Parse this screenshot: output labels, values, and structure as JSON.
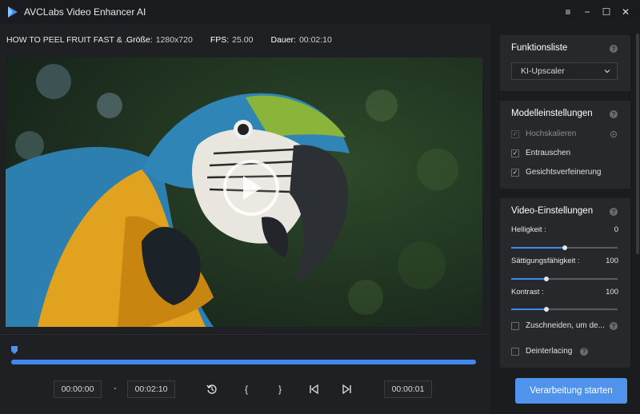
{
  "app": {
    "title": "AVCLabs Video Enhancer AI",
    "logo_color": "#3f8cf0"
  },
  "window_controls": {
    "menu": "≡",
    "minimize": "−",
    "maximize": "☐",
    "close": "✕"
  },
  "info": {
    "video_title": "HOW TO PEEL FRUIT FAST & ...",
    "size_label": "Größe:",
    "size_value": "1280x720",
    "fps_label": "FPS:",
    "fps_value": "25.00",
    "duration_label": "Dauer:",
    "duration_value": "00:02:10"
  },
  "timeline": {
    "progress_percent": 100,
    "color": "#3f88ee"
  },
  "controls": {
    "start_time": "00:00:00",
    "separator": "-",
    "end_time": "00:02:10",
    "current_time": "00:00:01",
    "icons": [
      "history-icon",
      "mark-in-icon",
      "mark-out-icon",
      "skip-start-icon",
      "skip-end-icon"
    ],
    "mark_in_glyph": "{",
    "mark_out_glyph": "}"
  },
  "panel": {
    "function_list": {
      "title": "Funktionsliste",
      "selected": "KI-Upscaler"
    },
    "model_settings": {
      "title": "Modelleinstellungen",
      "options": [
        {
          "label": "Hochskalieren",
          "checked": true,
          "disabled": true
        },
        {
          "label": "Entrauschen",
          "checked": true,
          "disabled": false
        },
        {
          "label": "Gesichtsverfeinerung",
          "checked": true,
          "disabled": false
        }
      ]
    },
    "video_settings": {
      "title": "Video-Einstellungen",
      "brightness": {
        "label": "Helligkeit :",
        "value": "0",
        "level_percent": 50
      },
      "saturation": {
        "label": "Sättigungsfähigkeit :",
        "value": "100",
        "level_percent": 33
      },
      "contrast": {
        "label": "Kontrast :",
        "value": "100",
        "level_percent": 33
      },
      "crop": {
        "label": "Zuschneiden, um de...",
        "checked": false
      },
      "deinterlace": {
        "label": "Deinterlacing",
        "checked": false
      }
    },
    "start_button": "Verarbeitung starten",
    "accent_color": "#4f93ec"
  }
}
